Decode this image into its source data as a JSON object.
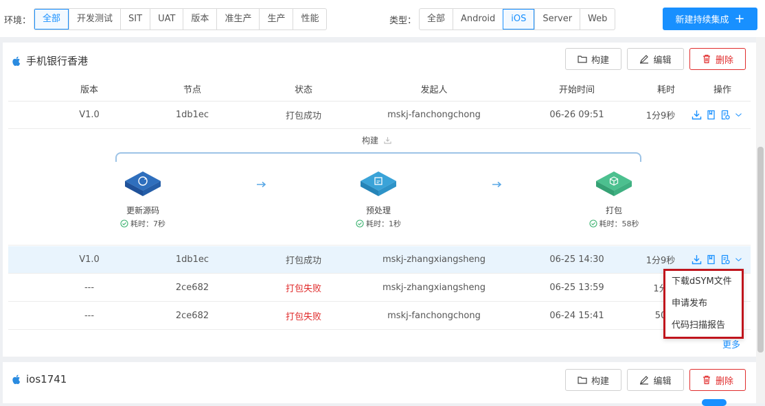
{
  "filters": {
    "env_label": "环境：",
    "env_options": [
      "全部",
      "开发测试",
      "SIT",
      "UAT",
      "版本",
      "准生产",
      "生产",
      "性能"
    ],
    "env_active": 0,
    "type_label": "类型：",
    "type_options": [
      "全部",
      "Android",
      "iOS",
      "Server",
      "Web"
    ],
    "type_active": 2,
    "new_button": "新建持续集成",
    "new_button_icon": "plus-icon"
  },
  "colors": {
    "primary": "#1890ff",
    "danger": "#e02b2b",
    "highlight_row": "#e9f4fd",
    "stage_blue": "#2f6fbd",
    "stage_lightblue": "#3aa3d8",
    "stage_green": "#4cc08f"
  },
  "card1": {
    "title": "手机银行香港",
    "buttons": {
      "build": "构建",
      "edit": "编辑",
      "delete": "删除"
    },
    "columns": [
      "版本",
      "节点",
      "状态",
      "发起人",
      "开始时间",
      "耗时",
      "操作"
    ],
    "rows": [
      {
        "version": "V1.0",
        "node": "1db1ec",
        "status": "打包成功",
        "status_ok": true,
        "user": "mskj-fanchongchong",
        "start": "06-26 09:51",
        "duration": "1分9秒"
      },
      {
        "version": "V1.0",
        "node": "1db1ec",
        "status": "打包成功",
        "status_ok": true,
        "user": "mskj-zhangxiangsheng",
        "start": "06-25 14:30",
        "duration": "1分9秒"
      },
      {
        "version": "---",
        "node": "2ce682",
        "status": "打包失败",
        "status_ok": false,
        "user": "mskj-zhangxiangsheng",
        "start": "06-25 13:59",
        "duration": "1分"
      },
      {
        "version": "---",
        "node": "2ce682",
        "status": "打包失败",
        "status_ok": false,
        "user": "mskj-fanchongchong",
        "start": "06-24 15:41",
        "duration": "50"
      }
    ],
    "pipeline": {
      "title": "构建",
      "stages": [
        {
          "name": "更新源码",
          "duration": "耗时：7秒"
        },
        {
          "name": "预处理",
          "duration": "耗时：1秒"
        },
        {
          "name": "打包",
          "duration": "耗时：58秒"
        }
      ]
    },
    "dropdown": [
      "下载dSYM文件",
      "申请发布",
      "代码扫描报告"
    ],
    "more": "更多"
  },
  "card2": {
    "title": "ios1741",
    "buttons": {
      "build": "构建",
      "edit": "编辑",
      "delete": "删除"
    }
  }
}
